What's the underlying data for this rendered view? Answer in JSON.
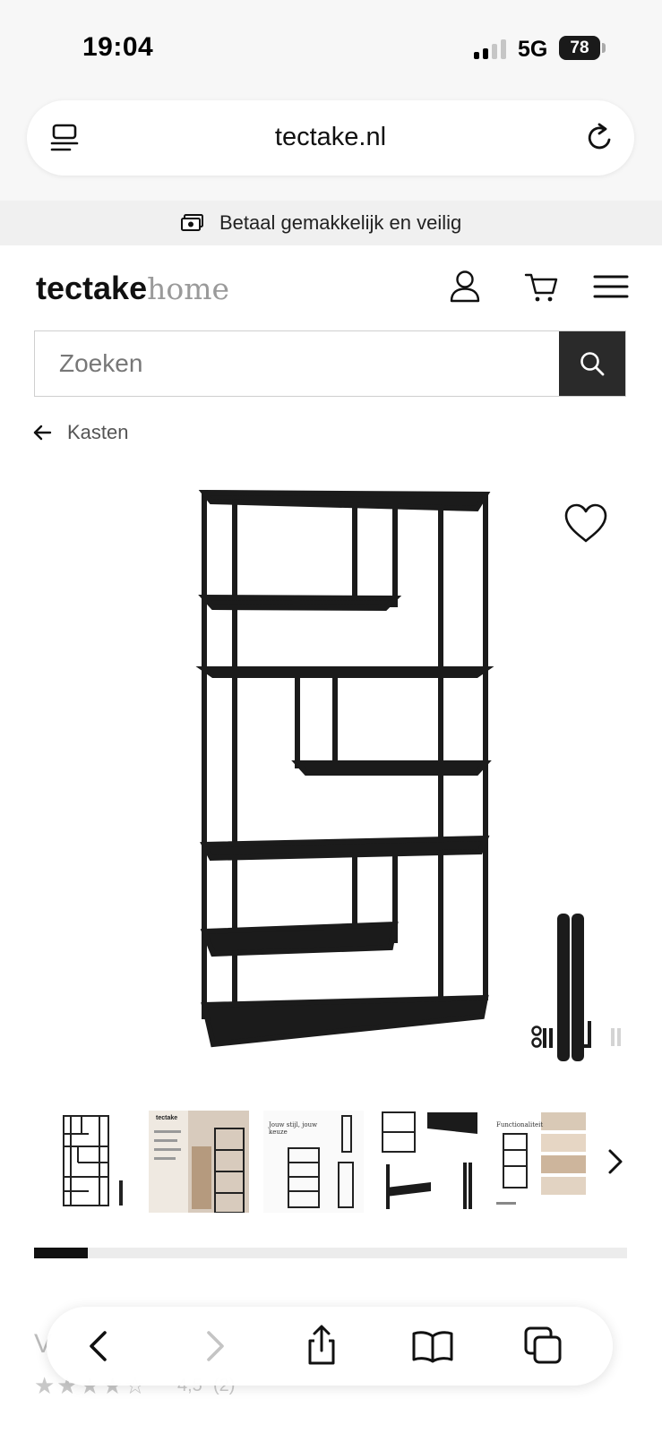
{
  "status_bar": {
    "time": "19:04",
    "network": "5G",
    "battery": "78"
  },
  "browser": {
    "url": "tectake.nl"
  },
  "promo": {
    "text": "Betaal gemakkelijk en veilig",
    "icon": "money-icon"
  },
  "header": {
    "logo_bold": "tectake",
    "logo_light": "home",
    "icons": [
      "user-icon",
      "cart-icon",
      "menu-icon"
    ]
  },
  "search": {
    "placeholder": "Zoeken",
    "value": ""
  },
  "breadcrumb": {
    "label": "Kasten"
  },
  "gallery": {
    "thumbnail_count": 5,
    "thumbnails": [
      {
        "title": ""
      },
      {
        "title": "tectake"
      },
      {
        "title": "Jouw stijl, jouw keuze"
      },
      {
        "title": ""
      },
      {
        "title": "Functionaliteit"
      }
    ],
    "progress": 0.09
  },
  "product": {
    "title_peek": "V",
    "rating_value": 4.5,
    "rating_text": "4,5",
    "rating_count": "(2)"
  },
  "toolbar": {
    "buttons": [
      "back-icon",
      "forward-icon",
      "share-icon",
      "bookmarks-icon",
      "tabs-icon"
    ]
  },
  "colors": {
    "accent": "#111111",
    "search_button": "#2a2a2a",
    "shelf": "#1b1b1b"
  }
}
